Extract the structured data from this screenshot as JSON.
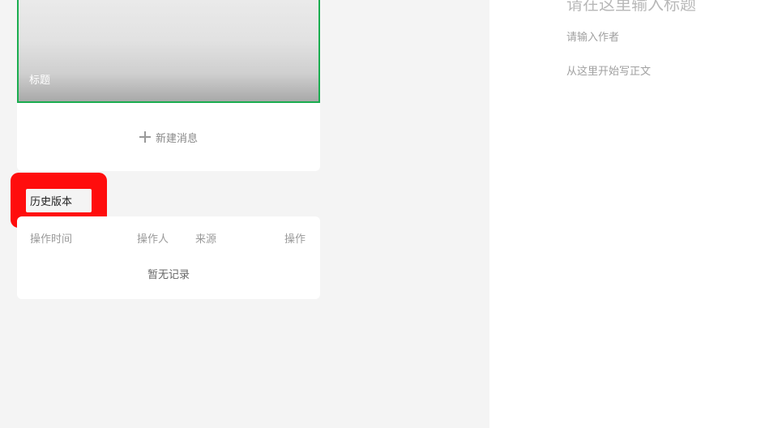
{
  "article": {
    "cover_title": "标题",
    "new_message_label": "新建消息"
  },
  "history": {
    "label": "历史版本",
    "columns": [
      "操作时间",
      "操作人",
      "来源",
      "操作"
    ],
    "empty_text": "暂无记录"
  },
  "editor": {
    "title_placeholder": "请在这里输入标题",
    "author_placeholder": "请输入作者",
    "body_placeholder": "从这里开始写正文"
  },
  "colors": {
    "accent_green": "#1aad4f",
    "highlight_red": "#ff0d0d"
  },
  "icons": {
    "new_message": "plus-icon"
  }
}
